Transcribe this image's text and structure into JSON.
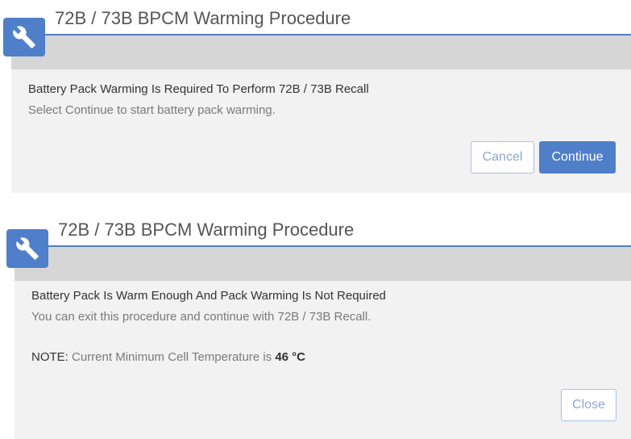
{
  "dialogs": [
    {
      "title": "72B / 73B BPCM Warming Procedure",
      "message_title": "Battery Pack Warming Is Required To Perform 72B / 73B Recall",
      "message_body": "Select Continue to start battery pack warming.",
      "buttons": {
        "cancel": "Cancel",
        "continue": "Continue"
      }
    },
    {
      "title": "72B / 73B BPCM Warming Procedure",
      "message_title": "Battery Pack Is Warm Enough And Pack Warming Is Not Required",
      "message_body": "You can exit this procedure and continue with 72B / 73B Recall.",
      "note_label": "NOTE:",
      "note_text": "Current Minimum Cell Temperature is",
      "note_value": "46 °C",
      "buttons": {
        "close": "Close"
      }
    }
  ],
  "colors": {
    "accent": "#4f7fc9",
    "panel": "#f2f2f2",
    "band": "#d6d6d6"
  },
  "icons": {
    "header": "wrench-icon"
  }
}
